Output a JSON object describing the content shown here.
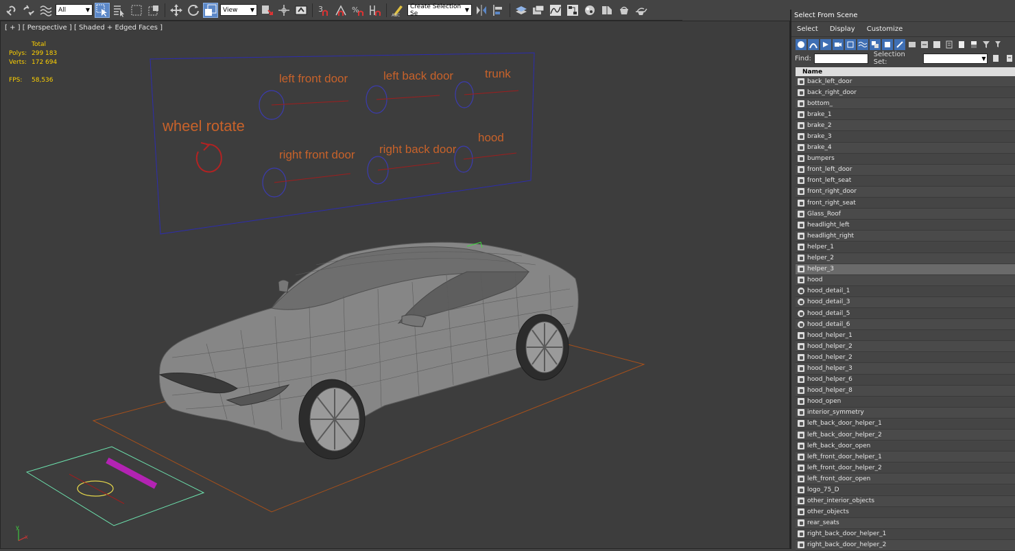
{
  "toolbar": {
    "filter_value": "All",
    "view_value": "View",
    "snap_label": "3",
    "selection_set_placeholder": "Create Selection Se"
  },
  "viewport": {
    "label": "[ + ] [ Perspective ] [ Shaded + Edged Faces ]",
    "stats": {
      "header": "Total",
      "polys_label": "Polys:",
      "polys_value": "299 183",
      "verts_label": "Verts:",
      "verts_value": "172 694",
      "fps_label": "FPS:",
      "fps_value": "58,536"
    },
    "control_labels": [
      "wheel rotate",
      "left front door",
      "left back door",
      "trunk",
      "right front door",
      "right back door",
      "hood"
    ],
    "axis_y": "y",
    "axis_x": "x"
  },
  "panel": {
    "title": "Select From Scene",
    "menu": [
      "Select",
      "Display",
      "Customize"
    ],
    "find_label": "Find:",
    "selection_set_label": "Selection Set:",
    "column_header": "Name",
    "items": [
      "back_left_door",
      "back_right_door",
      "bottom_",
      "brake_1",
      "brake_2",
      "brake_3",
      "brake_4",
      "bumpers",
      "front_left_door",
      "front_left_seat",
      "front_right_door",
      "front_right_seat",
      "Glass_Roof",
      "headlight_left",
      "headlight_right",
      "helper_1",
      "helper_2",
      "helper_3",
      "hood",
      "hood_detail_1",
      "hood_detail_3",
      "hood_detail_5",
      "hood_detail_6",
      "hood_helper_1",
      "hood_helper_2",
      "hood_helper_2",
      "hood_helper_3",
      "hood_helper_6",
      "hood_helper_8",
      "hood_open",
      "interior_symmetry",
      "left_back_door_helper_1",
      "left_back_door_helper_2",
      "left_back_door_open",
      "left_front_door_helper_1",
      "left_front_door_helper_2",
      "left_front_door_open",
      "logo_75_D",
      "other_interior_objects",
      "other_objects",
      "rear_seats",
      "right_back_door_helper_1",
      "right_back_door_helper_2"
    ],
    "selected_item": "helper_3"
  },
  "colors": {
    "viewport_bg": "#3d3d3d",
    "stats_text": "#ffd200",
    "label_orange": "#d2691e",
    "circle_blue": "#3b3bb0",
    "selection_blue": "#5b87c7"
  }
}
